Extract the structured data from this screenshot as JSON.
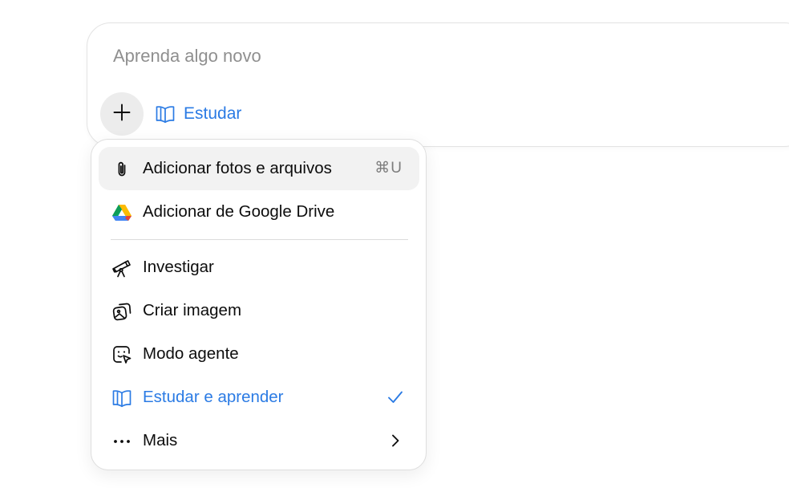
{
  "composer": {
    "placeholder": "Aprenda algo novo",
    "mode_label": "Estudar",
    "plus_icon": "plus-icon",
    "mode_icon": "book-open-icon"
  },
  "menu": {
    "items": [
      {
        "label": "Adicionar fotos e arquivos",
        "icon": "paperclip-icon",
        "shortcut": "⌘U",
        "highlighted": true
      },
      {
        "label": "Adicionar de Google Drive",
        "icon": "google-drive-icon"
      },
      {
        "label": "Investigar",
        "icon": "telescope-icon"
      },
      {
        "label": "Criar imagem",
        "icon": "image-gallery-icon"
      },
      {
        "label": "Modo agente",
        "icon": "agent-cursor-icon"
      },
      {
        "label": "Estudar e aprender",
        "icon": "book-open-icon",
        "selected": true,
        "trailing_icon": "checkmark-icon"
      },
      {
        "label": "Mais",
        "icon": "more-dots-icon",
        "trailing_icon": "chevron-right-icon"
      }
    ]
  },
  "colors": {
    "accent": "#2b7be4",
    "highlight_bg": "#f2f2f2",
    "plus_bg": "#ececec",
    "text": "#0d0d0d",
    "placeholder": "#8f8f8f",
    "shortcut": "#7c7c7c"
  }
}
